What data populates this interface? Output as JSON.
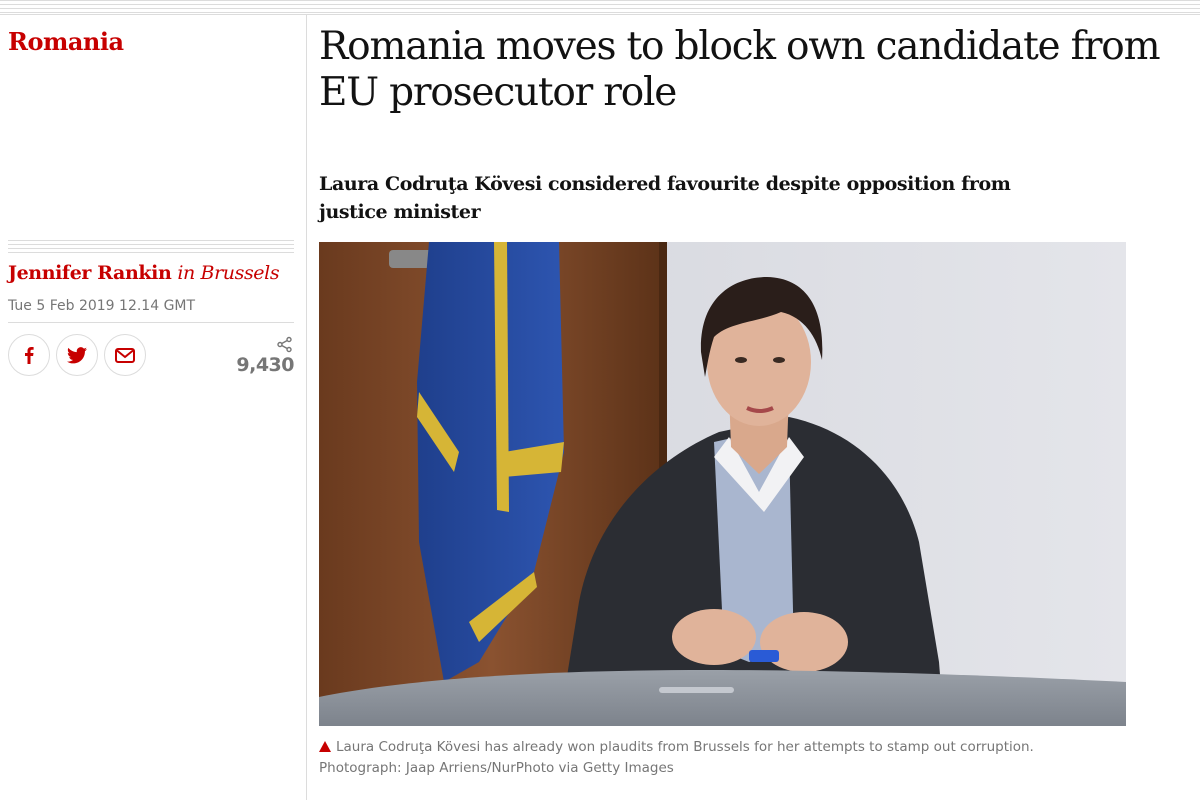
{
  "section": {
    "label": "Romania"
  },
  "article": {
    "headline": "Romania moves to block own candidate from EU prosecutor role",
    "standfirst": "Laura Codruţa Kövesi considered favourite despite opposition from justice minister",
    "byline": {
      "author": "Jennifer Rankin",
      "location": "in Brussels"
    },
    "dateline": "Tue 5 Feb 2019 12.14 GMT",
    "share": {
      "buttons": [
        {
          "name": "facebook-share-button",
          "icon": "facebook-icon"
        },
        {
          "name": "twitter-share-button",
          "icon": "twitter-icon"
        },
        {
          "name": "email-share-button",
          "icon": "email-icon"
        }
      ],
      "count": "9,430",
      "count_icon": "share-icon"
    },
    "image": {
      "caption": "Laura Codruţa Kövesi has already won plaudits from Brussels for her attempts to stamp out corruption.",
      "credit": "Photograph: Jaap Arriens/NurPhoto via Getty Images",
      "caption_icon": "triangle-icon"
    }
  },
  "colors": {
    "accent": "#c70000",
    "text": "#121212",
    "muted": "#767676",
    "rule": "#dcdcdc"
  }
}
